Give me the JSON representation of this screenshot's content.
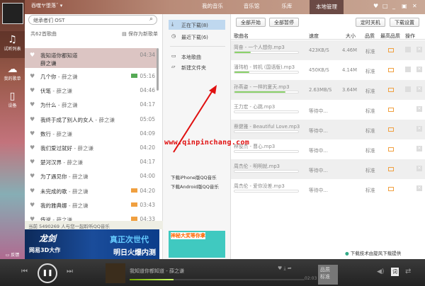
{
  "user": {
    "name": "吞噬ヤ堕落ˇ"
  },
  "sidebar": {
    "items": [
      {
        "label": "试听列表",
        "icon": "music-note-icon"
      },
      {
        "label": "我的歌单",
        "icon": "cloud-icon"
      },
      {
        "label": "设备",
        "icon": "phone-icon"
      }
    ],
    "feedback": "反馈"
  },
  "search": {
    "placeholder": "继承者们 OST"
  },
  "list": {
    "count": "共62首歌曲",
    "save": "保存为新歌单",
    "songs": [
      {
        "title": "我知道你都知道",
        "artist": "薛之谦",
        "time": "04:34",
        "badge": ""
      },
      {
        "title": "几个你",
        "artist": "薛之谦",
        "time": "05:16",
        "badge": "hd"
      },
      {
        "title": "伏笔",
        "artist": "薛之谦",
        "time": "04:46",
        "badge": ""
      },
      {
        "title": "为什么",
        "artist": "薛之谦",
        "time": "04:17",
        "badge": ""
      },
      {
        "title": "我终于成了别人的女人",
        "artist": "薛之谦",
        "time": "05:05",
        "badge": ""
      },
      {
        "title": "数行",
        "artist": "薛之谦",
        "time": "04:09",
        "badge": ""
      },
      {
        "title": "我们爱过就好",
        "artist": "薛之谦",
        "time": "04:20",
        "badge": ""
      },
      {
        "title": "楚河汉界",
        "artist": "薛之谦",
        "time": "04:17",
        "badge": ""
      },
      {
        "title": "为了遇见你",
        "artist": "薛之谦",
        "time": "04:00",
        "badge": ""
      },
      {
        "title": "未完成的歌",
        "artist": "薛之谦",
        "time": "04:20",
        "badge": "hq"
      },
      {
        "title": "我的雅典娜",
        "artist": "薛之谦",
        "time": "03:43",
        "badge": "hq"
      },
      {
        "title": "传说",
        "artist": "薛之谦",
        "time": "04:33",
        "badge": "hq"
      }
    ],
    "status": "当前 5490269 人与您一起聆听QQ音乐"
  },
  "ad1": {
    "a": "龙剑",
    "b": "网易3D大作",
    "c": "真正次世代",
    "d": "明日火爆内测"
  },
  "tabs": [
    "我的音乐",
    "音乐馆",
    "乐库",
    "本地管理"
  ],
  "mid": {
    "items": [
      "正在下载(8)",
      "最近下载(6)",
      "本地歌曲",
      "新建文件夹"
    ],
    "footer": [
      "下载iPhone版QQ音乐",
      "下载Android版QQ音乐"
    ],
    "ad": "神秘大奖等你拿"
  },
  "toolbar": {
    "start_all": "全部开始",
    "pause_all": "全部暂停",
    "timer": "定时关机",
    "settings": "下载设置"
  },
  "columns": [
    "歌曲名",
    "速度",
    "大小",
    "品质",
    "最高品质",
    "操作"
  ],
  "downloads": [
    {
      "name": "简奋 - 一个人想你.mp3",
      "speed": "423KB/S",
      "size": "4.46M",
      "quality": "标准",
      "progress": 0.25
    },
    {
      "name": "潘玮柏 - 转机 (国语版).mp3",
      "speed": "450KB/S",
      "size": "4.14M",
      "quality": "标准",
      "progress": 0.23
    },
    {
      "name": "孙燕姿 - 一样的夏天.mp3",
      "speed": "2.63MB/S",
      "size": "3.64M",
      "quality": "标准",
      "progress": 0.8
    },
    {
      "name": "王力宏 - 心跳.mp3",
      "speed": "等待中...",
      "size": "",
      "quality": "标准",
      "progress": 0
    },
    {
      "name": "蔡健雅 - Beautiful Love.mp3",
      "speed": "等待中...",
      "size": "",
      "quality": "标准",
      "progress": 0
    },
    {
      "name": "林俊杰 - 曹心.mp3",
      "speed": "等待中...",
      "size": "",
      "quality": "标准",
      "progress": 0
    },
    {
      "name": "周杰伦 - 明明就.mp3",
      "speed": "等待中...",
      "size": "",
      "quality": "标准",
      "progress": 0
    },
    {
      "name": "周杰伦 - 爱你没差.mp3",
      "speed": "等待中...",
      "size": "",
      "quality": "标准",
      "progress": 0
    }
  ],
  "credit": "下载技术由旋风下载提供",
  "player": {
    "title": "我知道你都知道",
    "artist": "薛之谦",
    "time": "02:03",
    "quality_label": "品质",
    "quality": "标准",
    "progress": 0.25,
    "lyrics": "词"
  },
  "watermark": "www.qinpinchang.com"
}
